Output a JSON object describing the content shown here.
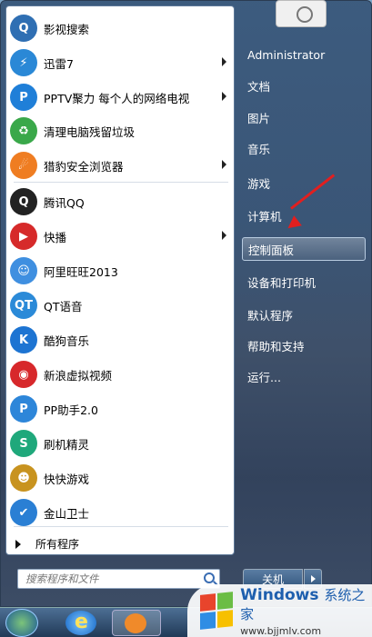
{
  "programs": [
    {
      "label": "影视搜索",
      "icon": "search-video-icon",
      "color": "#2f6fb3",
      "glyph": "Q",
      "arrow": false
    },
    {
      "label": "迅雷7",
      "icon": "thunder-bird-icon",
      "color": "#2a88d6",
      "glyph": "⚡",
      "arrow": true
    },
    {
      "label": "PPTV聚力 每个人的网络电视",
      "icon": "pptv-icon",
      "color": "#1f7fd8",
      "glyph": "P",
      "arrow": true
    },
    {
      "label": "清理电脑残留垃圾",
      "icon": "recycle-icon",
      "color": "#3aa84a",
      "glyph": "♻",
      "arrow": false
    },
    {
      "label": "猎豹安全浏览器",
      "icon": "cheetah-browser-icon",
      "color": "#ef7d22",
      "glyph": "☄",
      "arrow": true
    },
    {
      "label": "腾讯QQ",
      "icon": "qq-penguin-icon",
      "color": "#222222",
      "glyph": "Q",
      "arrow": false
    },
    {
      "label": "快播",
      "icon": "qvod-play-icon",
      "color": "#d62a2a",
      "glyph": "▶",
      "arrow": true
    },
    {
      "label": "阿里旺旺2013",
      "icon": "aliwangwang-icon",
      "color": "#3f8fe0",
      "glyph": "☺",
      "arrow": false
    },
    {
      "label": "QT语音",
      "icon": "qt-voice-icon",
      "color": "#2b8ad8",
      "glyph": "QT",
      "arrow": false
    },
    {
      "label": "酷狗音乐",
      "icon": "kugou-icon",
      "color": "#1d74d2",
      "glyph": "K",
      "arrow": false
    },
    {
      "label": "新浪虚拟视频",
      "icon": "sina-weibo-icon",
      "color": "#d7282b",
      "glyph": "◉",
      "arrow": false
    },
    {
      "label": "PP助手2.0",
      "icon": "pp-assistant-icon",
      "color": "#2d86d9",
      "glyph": "P",
      "arrow": false
    },
    {
      "label": "刷机精灵",
      "icon": "flash-sprite-icon",
      "color": "#1fa87b",
      "glyph": "S",
      "arrow": false
    },
    {
      "label": "快快游戏",
      "icon": "game-character-icon",
      "color": "#c8931f",
      "glyph": "☻",
      "arrow": false
    },
    {
      "label": "金山卫士",
      "icon": "shield-icon",
      "color": "#2a7fd4",
      "glyph": "✔",
      "arrow": false
    }
  ],
  "all_programs": "所有程序",
  "search": {
    "placeholder": "搜索程序和文件"
  },
  "right_items": [
    "Administrator",
    "文档",
    "图片",
    "音乐",
    "游戏",
    "计算机",
    "控制面板",
    "设备和打印机",
    "默认程序",
    "帮助和支持",
    "运行..."
  ],
  "highlighted_right": "控制面板",
  "shutdown_label": "关机",
  "watermark": {
    "title": "Windows",
    "subtitle": "系统之家",
    "url": "www.bjjmlv.com"
  }
}
